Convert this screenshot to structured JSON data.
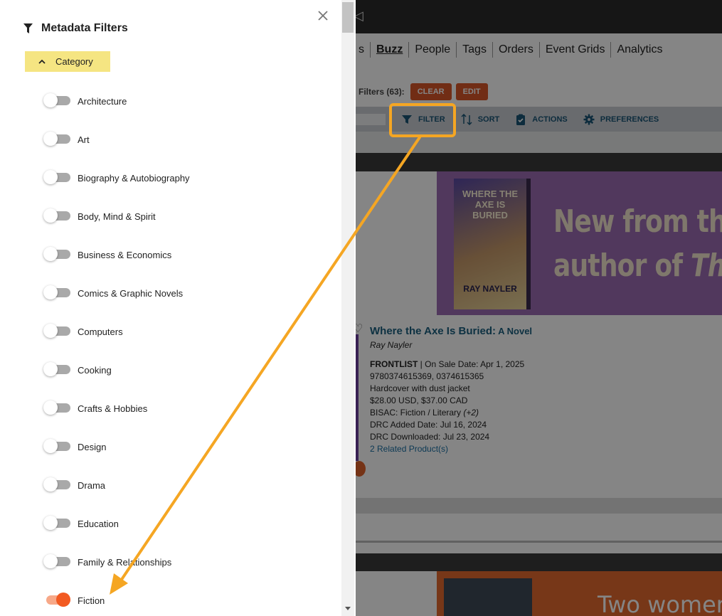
{
  "panel": {
    "title": "Metadata Filters",
    "category_header": "Category",
    "options": [
      {
        "label": "Architecture",
        "on": false
      },
      {
        "label": "Art",
        "on": false
      },
      {
        "label": "Biography & Autobiography",
        "on": false
      },
      {
        "label": "Body, Mind & Spirit",
        "on": false
      },
      {
        "label": "Business & Economics",
        "on": false
      },
      {
        "label": "Comics & Graphic Novels",
        "on": false
      },
      {
        "label": "Computers",
        "on": false
      },
      {
        "label": "Cooking",
        "on": false
      },
      {
        "label": "Crafts & Hobbies",
        "on": false
      },
      {
        "label": "Design",
        "on": false
      },
      {
        "label": "Drama",
        "on": false
      },
      {
        "label": "Education",
        "on": false
      },
      {
        "label": "Family & Relationships",
        "on": false
      },
      {
        "label": "Fiction",
        "on": true
      }
    ]
  },
  "background": {
    "nav_partial": "s",
    "nav": [
      "Buzz",
      "People",
      "Tags",
      "Orders",
      "Event Grids",
      "Analytics"
    ],
    "nav_active": "Buzz",
    "filters_label": "Filters (63):",
    "clear_label": "CLEAR",
    "edit_label": "EDIT",
    "toolbar": {
      "filter": "FILTER",
      "sort": "SORT",
      "actions": "ACTIONS",
      "preferences": "PREFERENCES"
    },
    "banner": {
      "book_title": "WHERE THE AXE IS BURIED",
      "book_author": "RAY NAYLER",
      "headline_1": "New from the L",
      "headline_2": "author of ",
      "headline_2_italic": "The"
    },
    "product": {
      "title": "Where the Axe Is Buried:",
      "subtitle": " A Novel",
      "author": "Ray Nayler",
      "frontlist": "FRONTLIST",
      "on_sale": " | On Sale Date: Apr 1, 2025",
      "isbns": "9780374615369, 0374615365",
      "format": "Hardcover with dust jacket",
      "price": "$28.00 USD, $37.00 CAD",
      "bisac": "BISAC: Fiction / Literary",
      "bisac_more": " (+2)",
      "drc_added": "DRC Added Date: Jul 16, 2024",
      "drc_downloaded": "DRC Downloaded: Jul 23, 2024",
      "related": "2 Related Product(s)"
    },
    "banner2_text": "Two women"
  },
  "colors": {
    "accent_orange": "#d9572a",
    "annotation_orange": "#f5a623",
    "toggle_on": "#f25a22",
    "category_highlight": "#f5e582",
    "link_blue": "#1a6fa3"
  }
}
